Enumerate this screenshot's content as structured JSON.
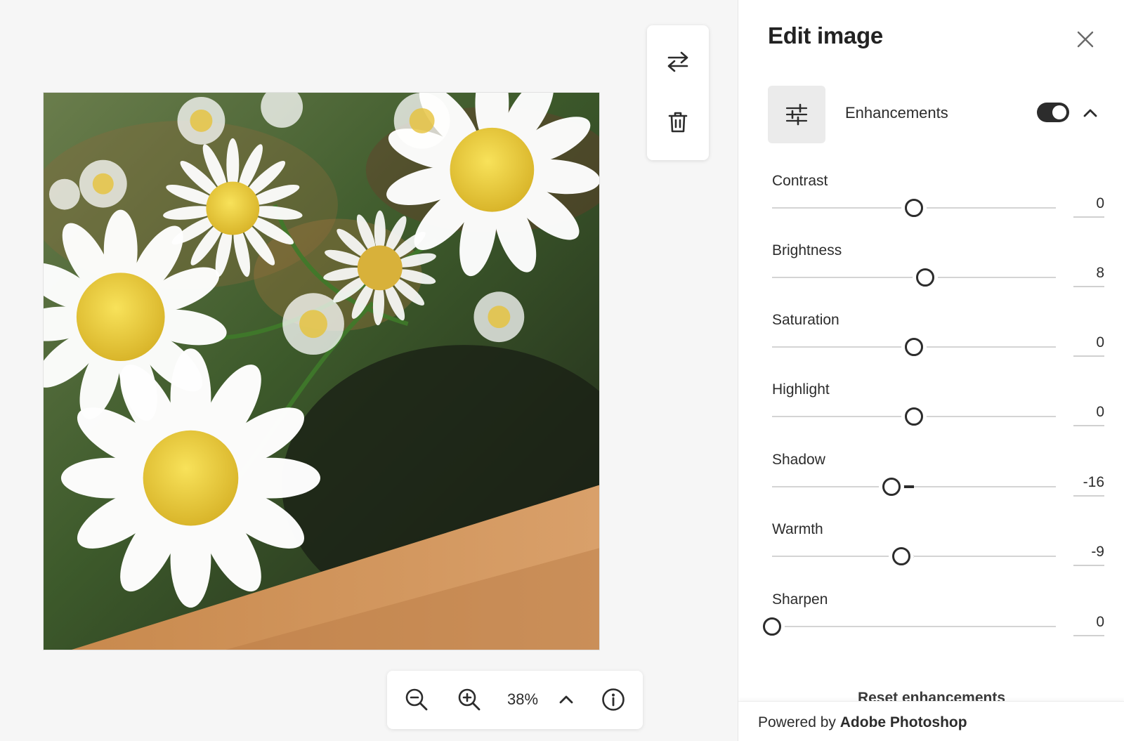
{
  "panel": {
    "title": "Edit image",
    "section_label": "Enhancements",
    "enhancements_enabled": true,
    "reset_label": "Reset enhancements",
    "footer_prefix": "Powered by",
    "footer_brand": "Adobe Photoshop"
  },
  "sliders": [
    {
      "label": "Contrast",
      "value": "0",
      "level": 0,
      "min": -100,
      "max": 100
    },
    {
      "label": "Brightness",
      "value": "8",
      "level": 8,
      "min": -100,
      "max": 100
    },
    {
      "label": "Saturation",
      "value": "0",
      "level": 0,
      "min": -100,
      "max": 100
    },
    {
      "label": "Highlight",
      "value": "0",
      "level": 0,
      "min": -100,
      "max": 100
    },
    {
      "label": "Shadow",
      "value": "-16",
      "level": -16,
      "min": -100,
      "max": 100
    },
    {
      "label": "Warmth",
      "value": "-9",
      "level": -9,
      "min": -100,
      "max": 100
    },
    {
      "label": "Sharpen",
      "value": "0",
      "level": 0,
      "min": 0,
      "max": 100
    }
  ],
  "zoom": {
    "level": "38%"
  },
  "icons": {
    "swap": "swap-arrows-icon",
    "trash": "trash-icon",
    "zoom_out": "zoom-out-icon",
    "zoom_in": "zoom-in-icon",
    "chevron_up": "chevron-up-icon",
    "info": "info-icon",
    "close": "close-icon",
    "adjustments": "sliders-icon"
  },
  "colors": {
    "accent": "#2c2c2c",
    "panel_bg": "#ffffff",
    "canvas_bg": "#f6f6f6"
  }
}
